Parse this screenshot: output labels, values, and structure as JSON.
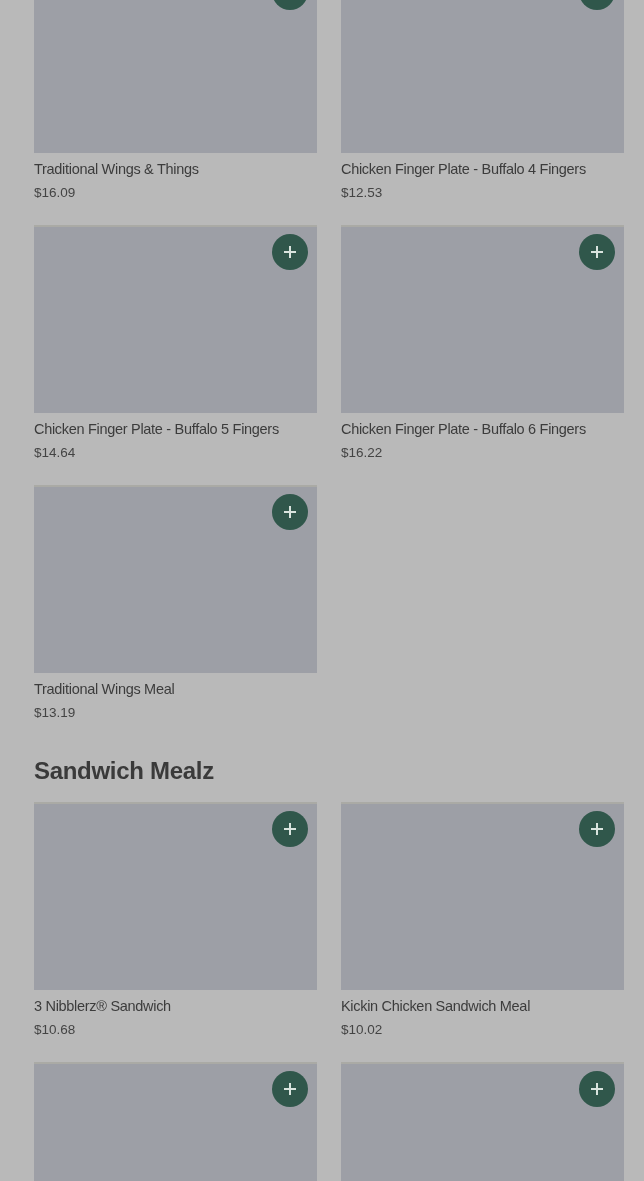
{
  "sections": [
    {
      "items": [
        {
          "kind": "product",
          "name": "Traditional Wings & Things",
          "price": "$16.09"
        },
        {
          "kind": "product",
          "name": "Chicken Finger Plate - Buffalo 4 Fingers",
          "price": "$12.53"
        },
        {
          "kind": "product",
          "name": "Chicken Finger Plate - Buffalo 5 Fingers",
          "price": "$14.64"
        },
        {
          "kind": "product",
          "name": "Chicken Finger Plate - Buffalo 6 Fingers",
          "price": "$16.22"
        },
        {
          "kind": "product",
          "name": "Traditional Wings Meal",
          "price": "$13.19"
        }
      ]
    },
    {
      "title": "Sandwich Mealz",
      "items": [
        {
          "kind": "product",
          "name": "3 Nibblerz® Sandwich",
          "price": "$10.68"
        },
        {
          "kind": "product",
          "name": "Kickin Chicken Sandwich Meal",
          "price": "$10.02"
        },
        {
          "kind": "image_only"
        },
        {
          "kind": "image_only"
        }
      ]
    }
  ]
}
